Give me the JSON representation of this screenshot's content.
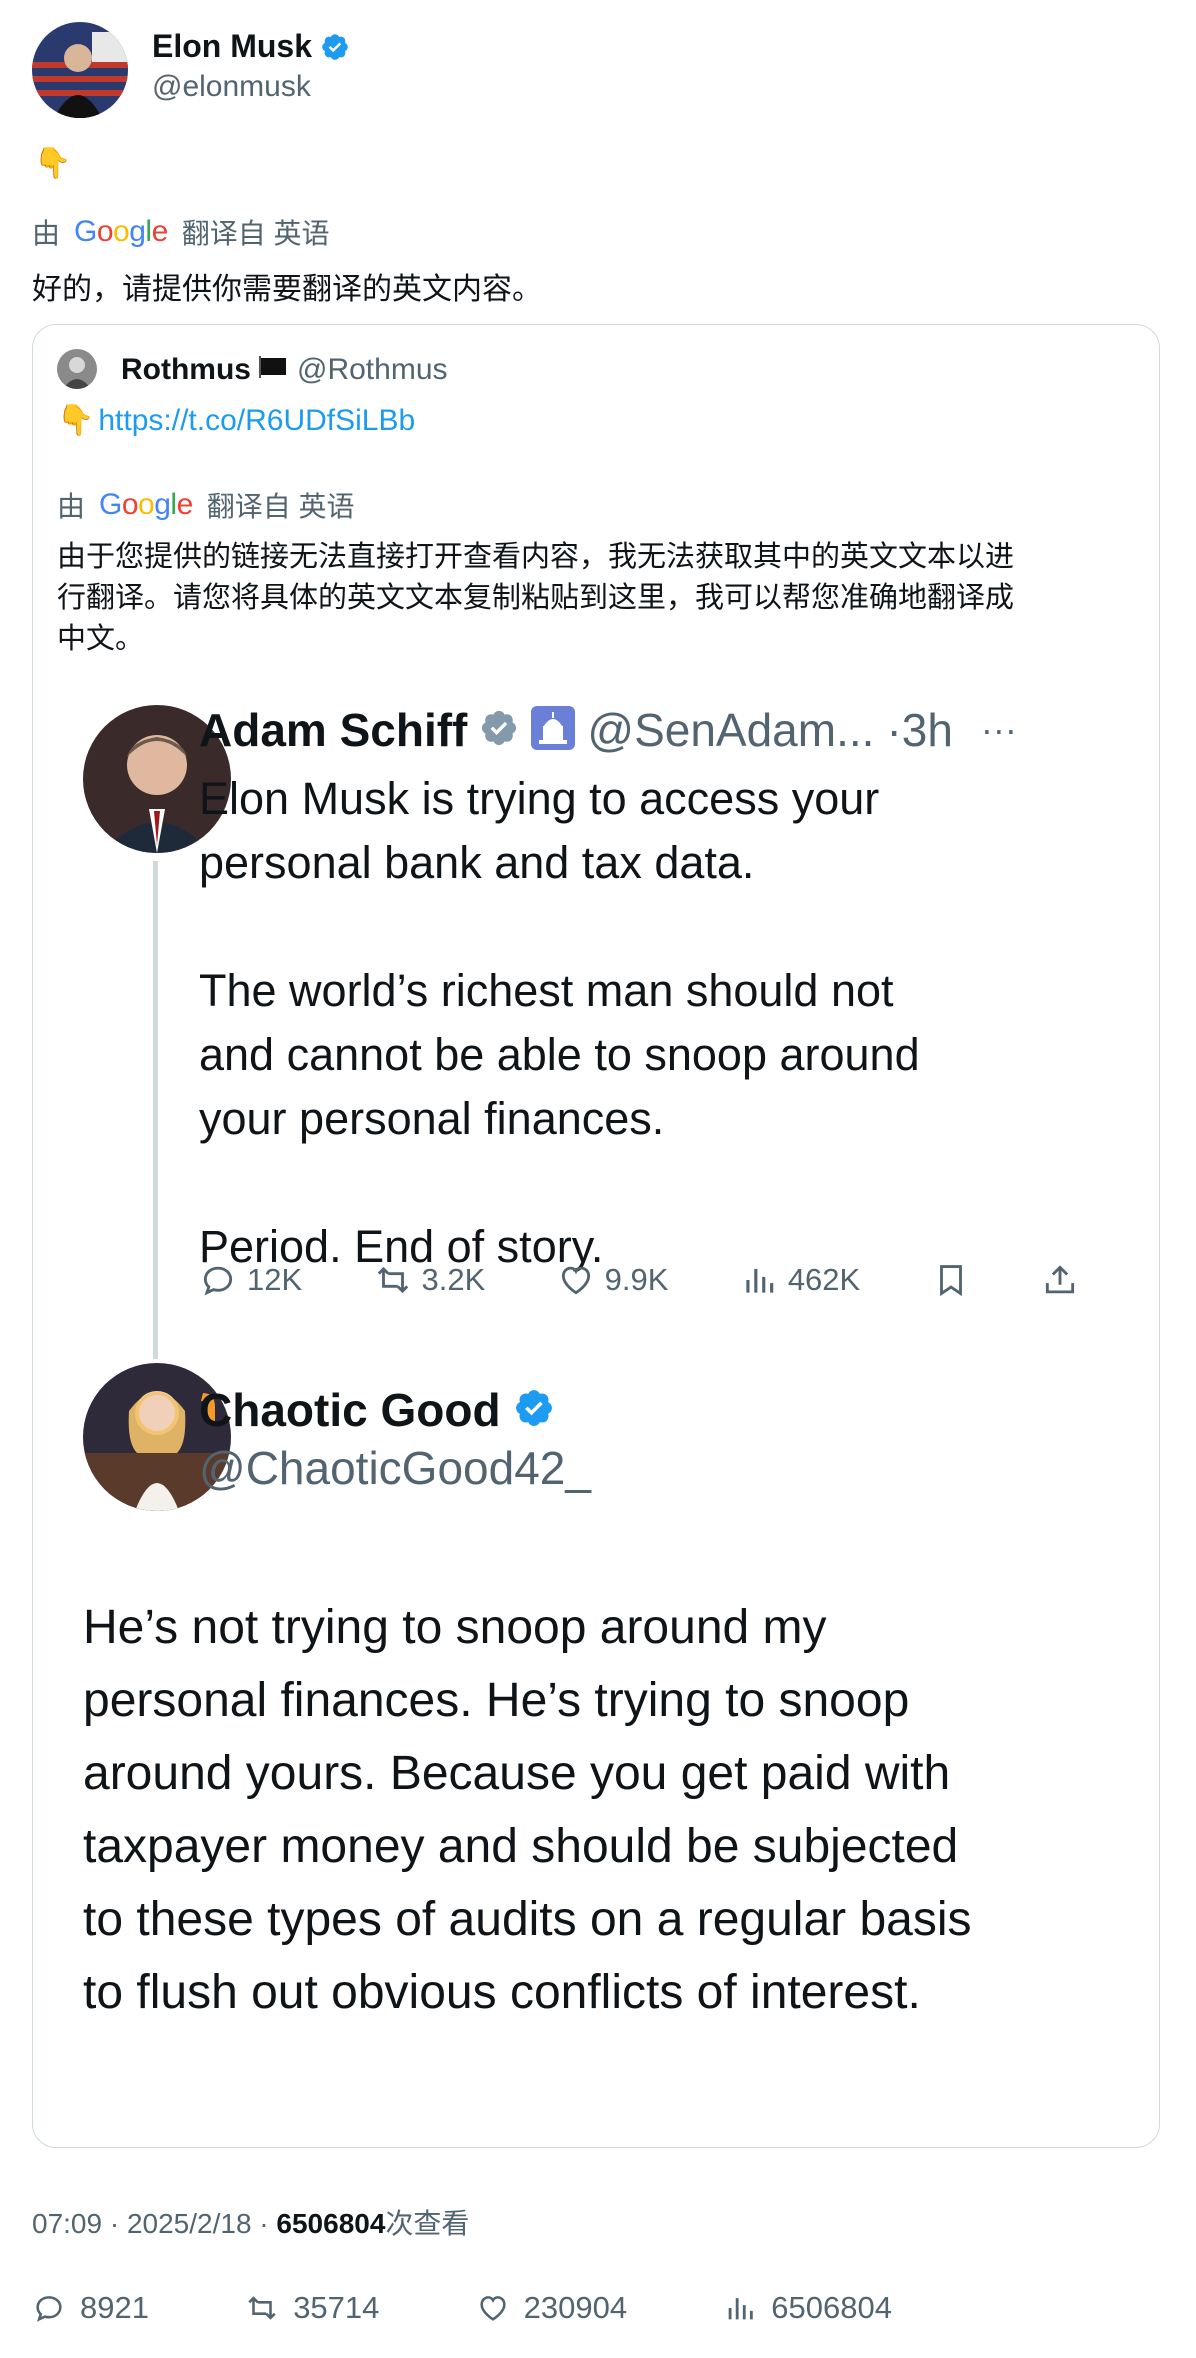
{
  "tweet": {
    "author_name": "Elon Musk",
    "author_handle": "@elonmusk",
    "emoji": "👇",
    "translation": {
      "by": "由",
      "google": "Google",
      "from": "翻译自 英语"
    },
    "translated_text": "好的，请提供你需要翻译的英文内容。",
    "meta": {
      "time": "07:09 · 2025/2/18 · ",
      "views_number": "6506804",
      "views_suffix": "次查看"
    },
    "actions": {
      "replies": "8921",
      "retweets": "35714",
      "likes": "230904",
      "views": "6506804"
    }
  },
  "quote": {
    "author_name": "Rothmus",
    "flag": "🏴",
    "author_handle": "@Rothmus",
    "emoji": "👇",
    "link": "https://t.co/R6UDfSiLBb",
    "translation": {
      "by": "由",
      "google": "Google",
      "from": "翻译自 英语"
    },
    "translated_text_line1": "由于您提供的链接无法直接打开查看内容，我无法获取其中的英文文本以进",
    "translated_text_line2": "行翻译。请您将具体的英文文本复制粘贴到这里，我可以帮您准确地翻译成",
    "translated_text_line3": "中文。"
  },
  "screenshot": {
    "post1": {
      "name": "Adam Schiff",
      "handle": "@SenAdam...",
      "time": "·3h",
      "more": "···",
      "line1": "Elon Musk is trying to access your",
      "line2": "personal bank and tax data.",
      "line3": "The world’s richest man should not",
      "line4": "and cannot be able to snoop around",
      "line5": "your personal finances.",
      "line6": "Period. End of story.",
      "replies": "12K",
      "retweets": "3.2K",
      "likes": "9.9K",
      "views": "462K"
    },
    "post2": {
      "name": "Chaotic Good",
      "handle": "@ChaoticGood42_",
      "line1": "He’s not trying to snoop around my",
      "line2": "personal finances.  He’s trying to snoop",
      "line3": "around yours. Because you get paid with",
      "line4": "taxpayer money and should be subjected",
      "line5": "to these types of audits on a regular basis",
      "line6": "to flush out obvious conflicts of interest."
    }
  },
  "colors": {
    "link": "#1d9bf0",
    "verified": "#1d9bf0",
    "secondary_text": "#536471",
    "border": "#cfd9de"
  }
}
